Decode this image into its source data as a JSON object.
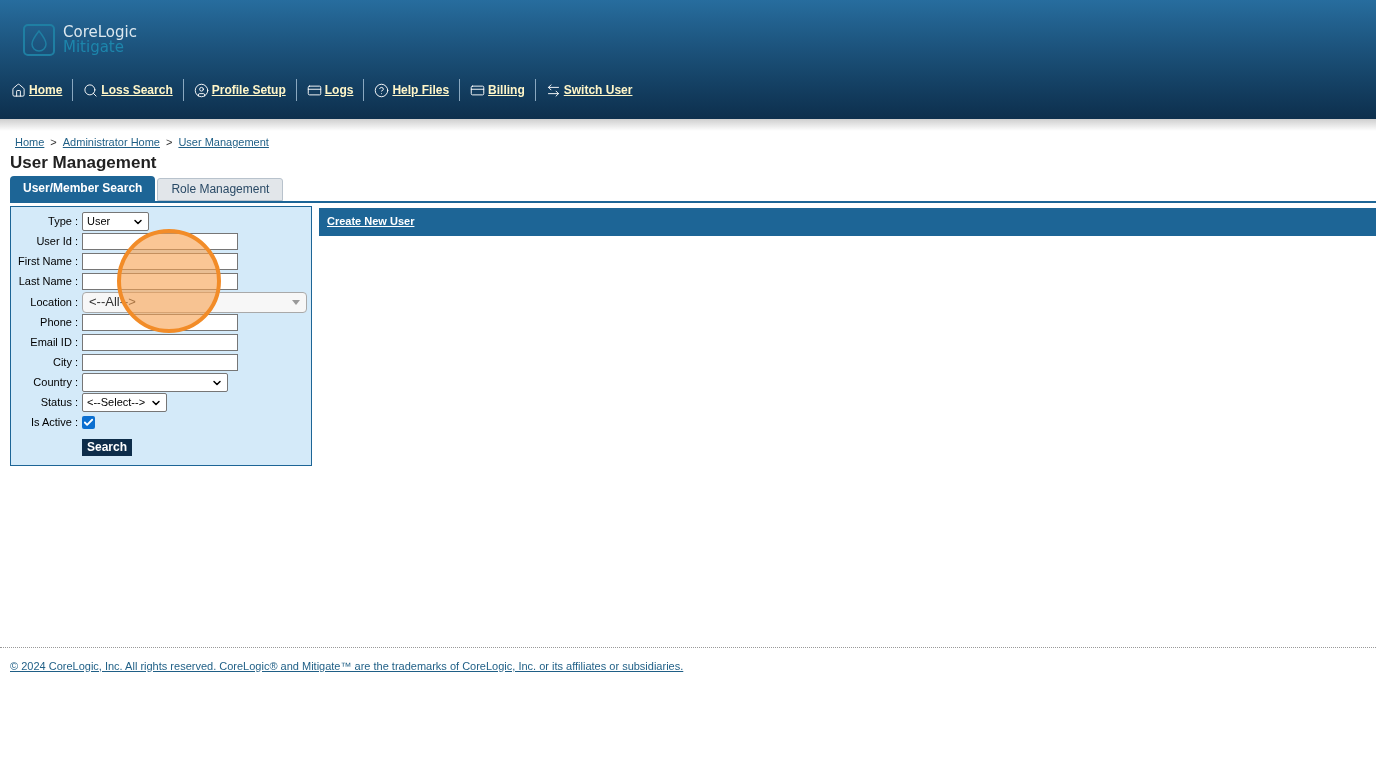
{
  "logo": {
    "line1": "CoreLogic",
    "line2": "Mitigate"
  },
  "nav": [
    {
      "label": "Home"
    },
    {
      "label": "Loss Search"
    },
    {
      "label": "Profile Setup"
    },
    {
      "label": "Logs"
    },
    {
      "label": "Help Files"
    },
    {
      "label": "Billing"
    },
    {
      "label": "Switch User"
    }
  ],
  "breadcrumb": {
    "separator": ">",
    "items": [
      "Home",
      "Administrator Home",
      "User Management"
    ]
  },
  "page_title": "User Management",
  "tabs": [
    {
      "label": "User/Member Search",
      "selected": true
    },
    {
      "label": "Role Management",
      "selected": false
    }
  ],
  "form": {
    "fields": [
      {
        "kind": "select",
        "label": "Type :",
        "value": "User"
      },
      {
        "kind": "text",
        "label": "User Id :"
      },
      {
        "kind": "text",
        "label": "First Name :"
      },
      {
        "kind": "text",
        "label": "Last Name :"
      },
      {
        "kind": "combo",
        "label": "Location :",
        "value": "<--All-->"
      },
      {
        "kind": "text",
        "label": "Phone :"
      },
      {
        "kind": "text",
        "label": "Email ID :"
      },
      {
        "kind": "text",
        "label": "City :"
      },
      {
        "kind": "select",
        "label": "Country :"
      },
      {
        "kind": "select",
        "label": "Status :",
        "value": "<--Select-->"
      },
      {
        "kind": "checkbox",
        "label": "Is Active :",
        "checked": true
      }
    ],
    "button": "Search"
  },
  "action_bar": {
    "link": "Create New User"
  },
  "footer": "© 2024 CoreLogic, Inc. All rights reserved. CoreLogic® and Mitigate™ are the trademarks of CoreLogic, Inc. or its affiliates or subsidiaries."
}
